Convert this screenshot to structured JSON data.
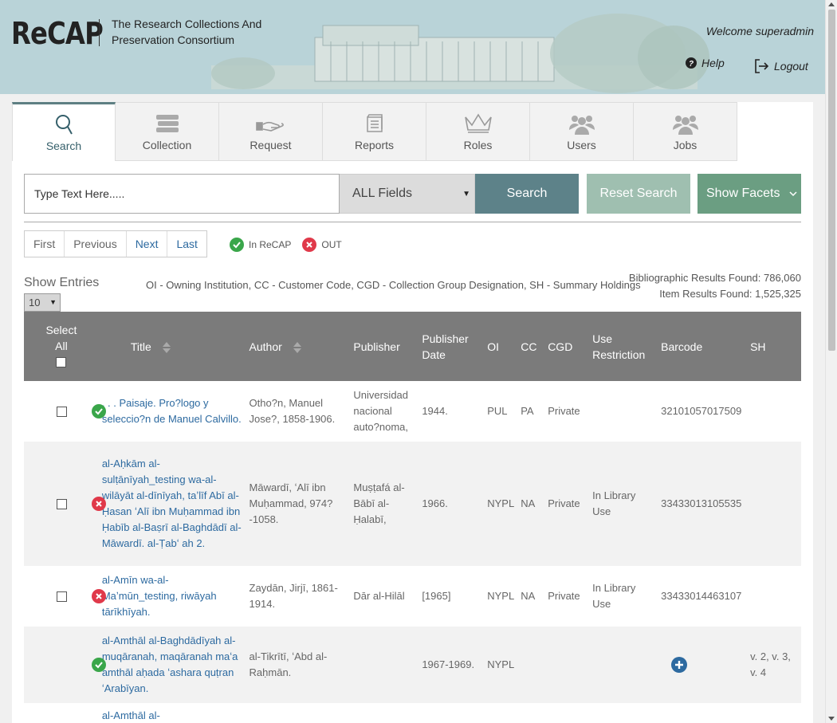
{
  "header": {
    "logo": "ReCAP",
    "tagline": "The Research Collections And Preservation Consortium",
    "welcome": "Welcome superadmin",
    "help": "Help",
    "logout": "Logout"
  },
  "tabs": [
    {
      "label": "Search",
      "icon": "search-icon",
      "active": true
    },
    {
      "label": "Collection",
      "icon": "books-icon"
    },
    {
      "label": "Request",
      "icon": "hand-book-icon"
    },
    {
      "label": "Reports",
      "icon": "reports-icon"
    },
    {
      "label": "Roles",
      "icon": "crown-icon"
    },
    {
      "label": "Users",
      "icon": "users-icon"
    },
    {
      "label": "Jobs",
      "icon": "jobs-icon"
    }
  ],
  "search": {
    "placeholder": "Type Text Here.....",
    "field": "ALL Fields",
    "search_btn": "Search",
    "reset_btn": "Reset Search",
    "facets_btn": "Show Facets"
  },
  "pager": {
    "first": "First",
    "previous": "Previous",
    "next": "Next",
    "last": "Last"
  },
  "legend": {
    "in": "In ReCAP",
    "out": "OUT"
  },
  "entries": {
    "label": "Show Entries",
    "value": "10"
  },
  "abbrev": "OI - Owning Institution, CC - Customer Code, CGD - Collection Group Designation, SH - Summary Holdings",
  "results": {
    "bib": "Bibliographic Results Found: 786,060",
    "item": "Item Results Found: 1,525,325"
  },
  "table": {
    "headers": {
      "select": "Select All",
      "title": "Title",
      "author": "Author",
      "publisher": "Publisher",
      "pubdate": "Publisher Date",
      "oi": "OI",
      "cc": "CC",
      "cgd": "CGD",
      "use": "Use Restriction",
      "barcode": "Barcode",
      "sh": "SH"
    },
    "rows": [
      {
        "status": "in",
        "title": ". . . Paisaje. Pro?logo y seleccio?n de Manuel Calvillo.",
        "author": "Otho?n, Manuel Jose?, 1858-1906.",
        "publisher": "Universidad nacional auto?noma,",
        "date": "1944.",
        "oi": "PUL",
        "cc": "PA",
        "cgd": "Private",
        "use": "",
        "barcode": "32101057017509",
        "sh": ""
      },
      {
        "status": "out",
        "title": "al-Aḥkām al-sulṭānīyah_testing wa-al-wilāyāt al-dīnīyah, taʼlīf Abī al-Ḥasan ʻAlī ibn Muḥammad ibn Ḥabīb al-Baṣrī al-Baghdādī al-Māwardī. al-Ṭabʻ ah 2.",
        "author": "Māwardī, ʻAlī ibn Muḥammad, 974?-1058.",
        "publisher": "Muṣṭafá al-Bābī al-Ḥalabī,",
        "date": "1966.",
        "oi": "NYPL",
        "cc": "NA",
        "cgd": "Private",
        "use": "In Library Use",
        "barcode": "33433013105535",
        "sh": ""
      },
      {
        "status": "out",
        "title": "al-Amīn wa-al-Maʼmūn_testing, riwāyah tārīkhīyah.",
        "author": "Zaydān, Jirjī, 1861-1914.",
        "publisher": "Dār al-Hilāl",
        "date": "[1965]",
        "oi": "NYPL",
        "cc": "NA",
        "cgd": "Private",
        "use": "In Library Use",
        "barcode": "33433014463107",
        "sh": ""
      },
      {
        "status": "in",
        "title": "al-Amthāl al-Baghdādīyah al-muqāranah, maqāranah maʻa amthāl aḥada ʻashara quṭran ʻArabīyan.",
        "author": "al-Tikrītī, ʻAbd al-Raḥmān.",
        "publisher": "",
        "date": "1967-1969.",
        "oi": "NYPL",
        "cc": "",
        "cgd": "",
        "use": "",
        "barcode": "",
        "sh": "v. 2, v. 3, v. 4",
        "expand": true,
        "no_checkbox": true
      },
      {
        "status": "",
        "title": "al-Amthāl al-",
        "author": "",
        "publisher": "",
        "date": "",
        "oi": "",
        "cc": "",
        "cgd": "",
        "use": "",
        "barcode": "",
        "sh": "",
        "no_checkbox": true
      }
    ]
  }
}
